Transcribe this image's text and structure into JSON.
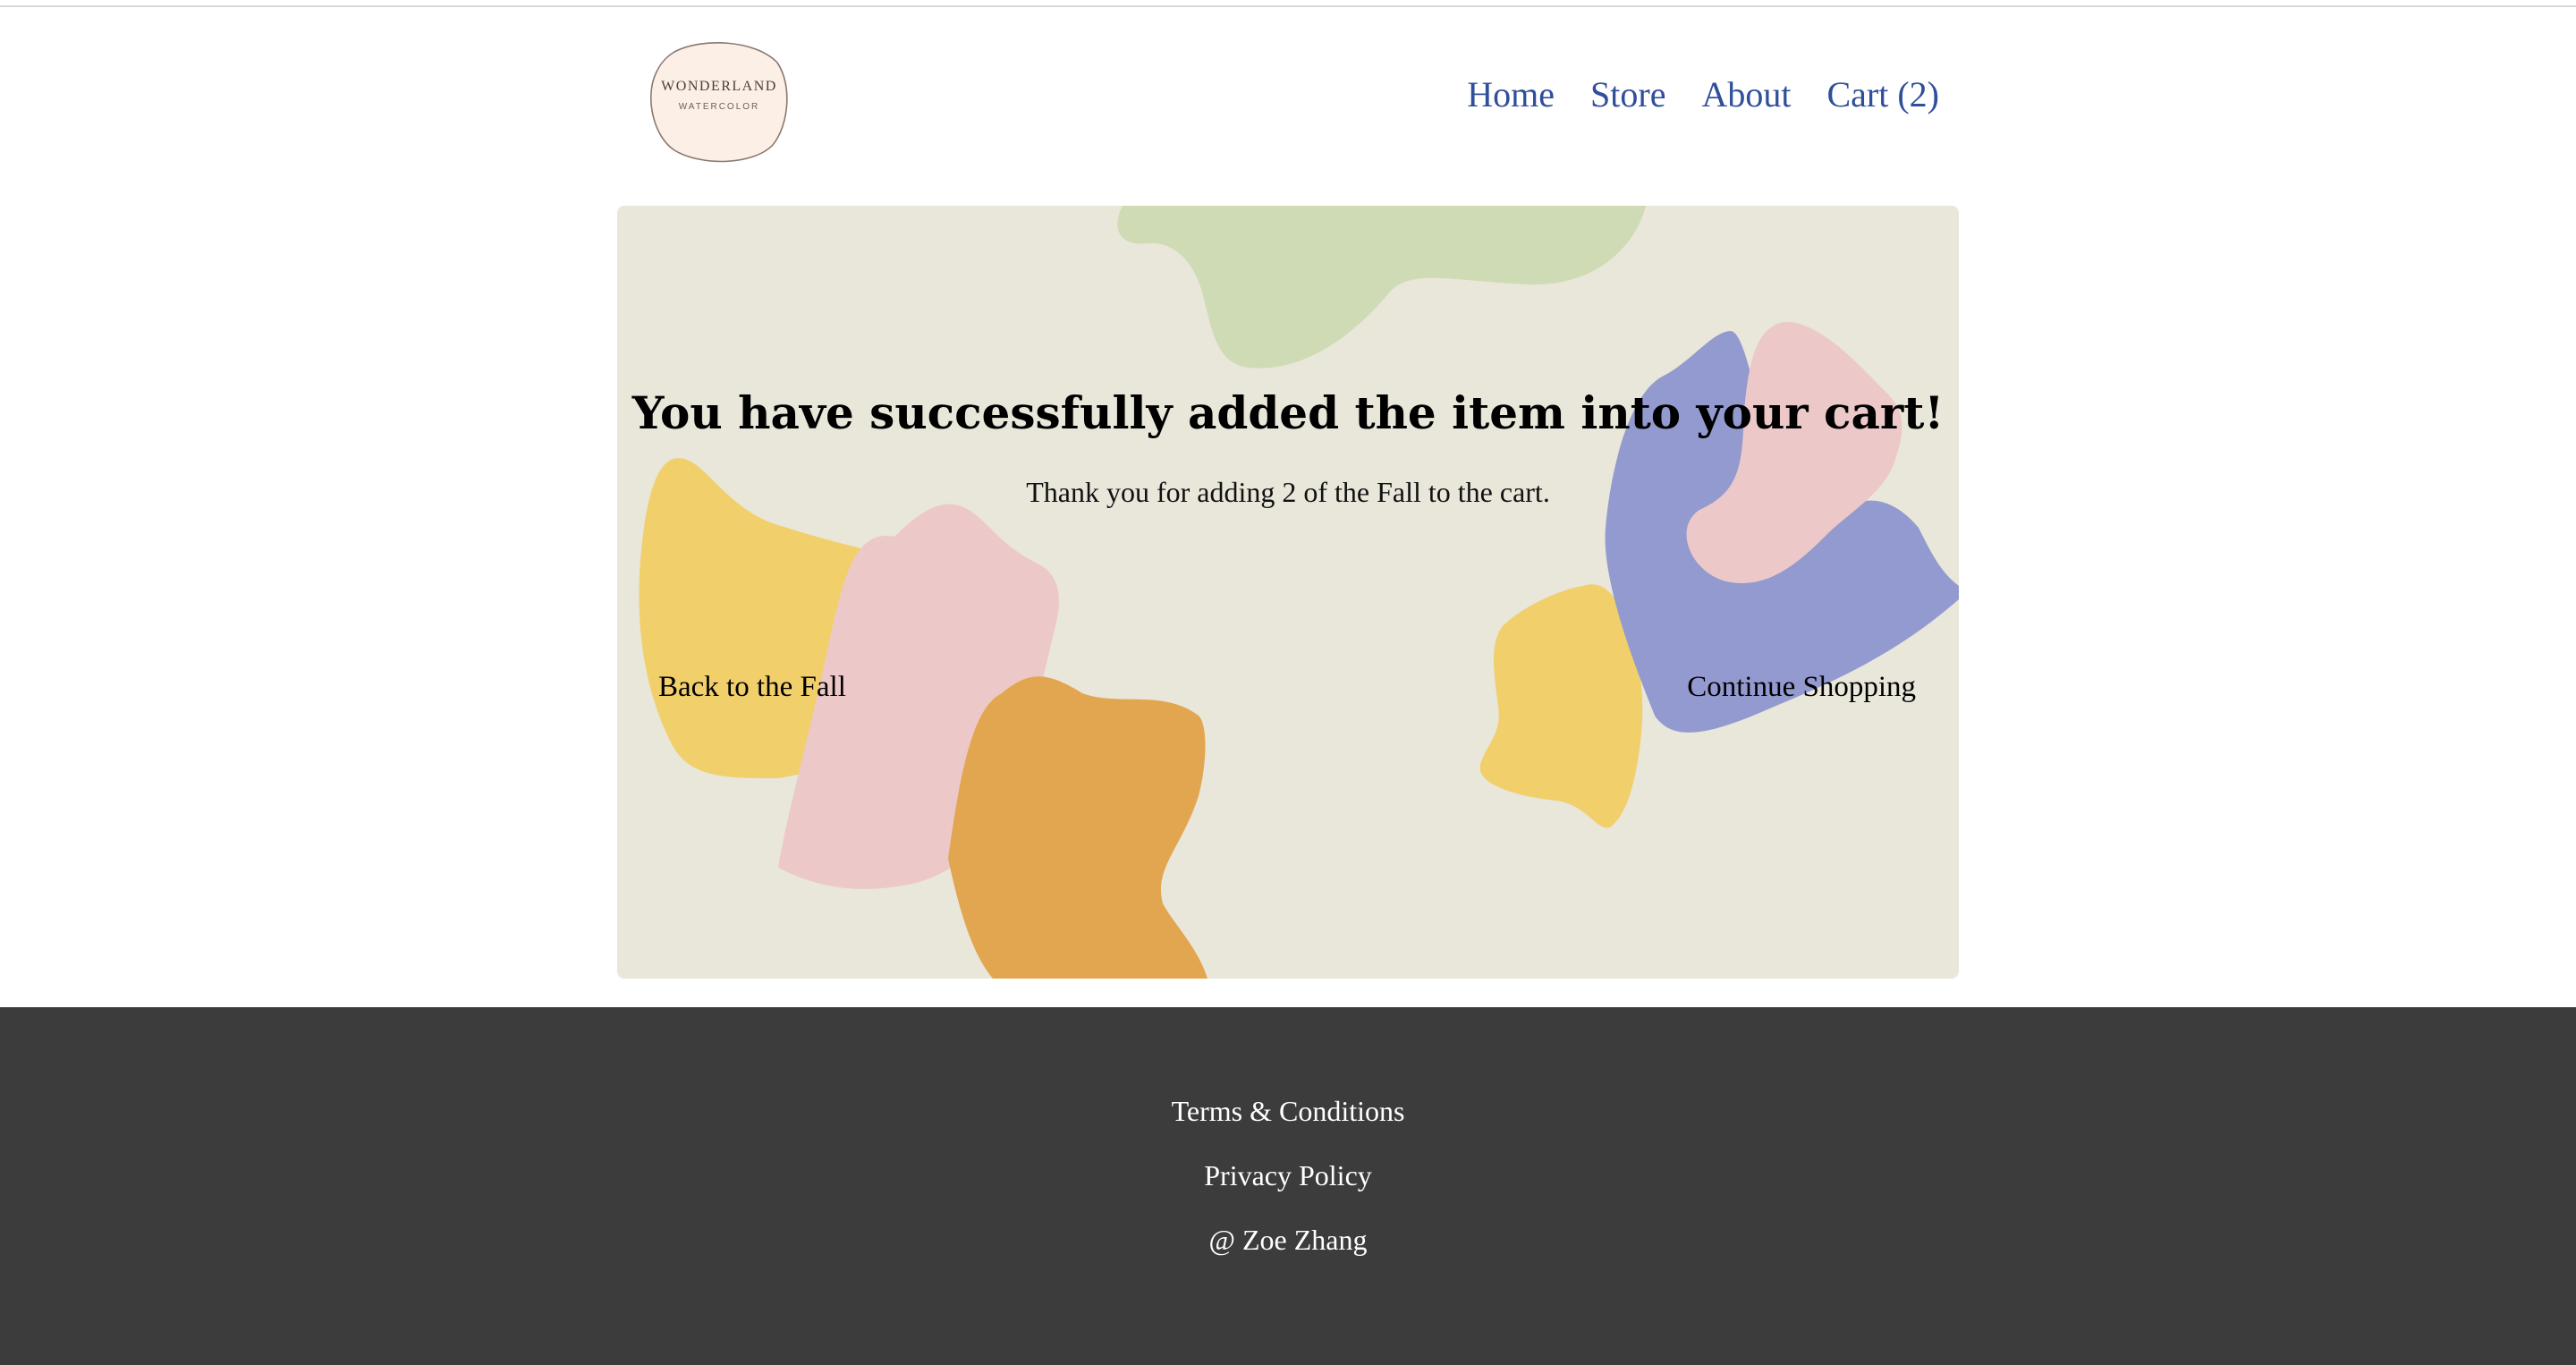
{
  "logo": {
    "name": "WONDERLAND",
    "tagline": "WATERCOLOR"
  },
  "nav": {
    "home": "Home",
    "store": "Store",
    "about": "About",
    "cart": "Cart (2)"
  },
  "hero": {
    "title": "You have successfully added the item into your cart!",
    "message": "Thank you for adding 2 of the Fall to the cart.",
    "back_link": "Back to the Fall",
    "continue_link": "Continue Shopping"
  },
  "footer": {
    "terms": "Terms & Conditions",
    "privacy": "Privacy Policy",
    "copyright": "@ Zoe Zhang"
  },
  "colors": {
    "nav_link": "#2f4f9a",
    "hero_bg": "#e9e6da",
    "footer_bg": "#3c3c3c",
    "blob_green": "#cfdbb4",
    "blob_yellow": "#f1cf6b",
    "blob_pink": "#ecc9c8",
    "blob_orange": "#e3a650",
    "blob_purple": "#939acf"
  }
}
